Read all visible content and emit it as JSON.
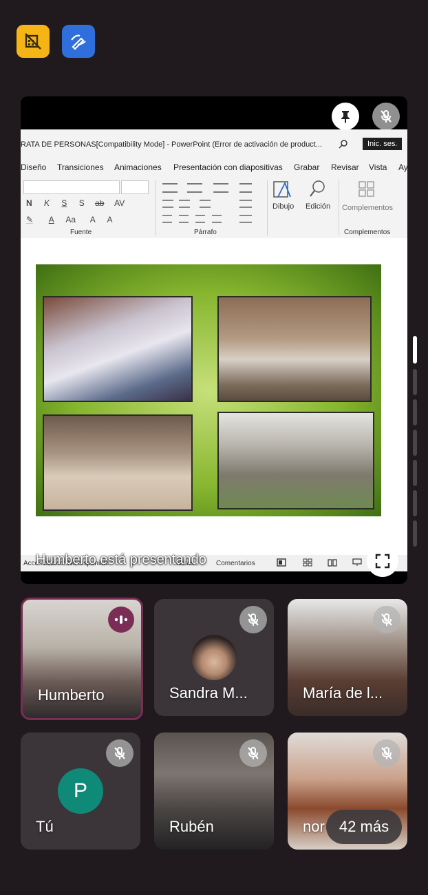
{
  "toolbar": {
    "left_button_icon": "no-video-icon",
    "right_button_icon": "pen-annotate-icon",
    "left_color": "#f5b516",
    "right_color": "#2f6fdb"
  },
  "presentation": {
    "window_title": "RATA DE PERSONAS[Compatibility Mode]  -  PowerPoint (Error de activación de product...",
    "signin_label": "Inic. ses.",
    "tabs": [
      "Diseño",
      "Transiciones",
      "Animaciones",
      "Presentación con diapositivas",
      "Grabar",
      "Revisar",
      "Vista",
      "Ay"
    ],
    "ribbon": {
      "font_group": "Fuente",
      "paragraph_group": "Párrafo",
      "draw_label": "Dibujo",
      "edit_label": "Edición",
      "addins_label": "Complementos",
      "addins_group": "Complementos",
      "font_buttons": [
        "N",
        "K",
        "S",
        "S",
        "ab",
        "AV"
      ],
      "font_buttons2": [
        "Aa",
        "A",
        "A",
        "A"
      ]
    },
    "statusbar": {
      "accessibility": "Accesibilidad: No disponible",
      "notes": "Notas",
      "comments": "Comentarios"
    },
    "presenter_caption": "Humberto está presentando"
  },
  "participants": [
    {
      "name": "Humberto",
      "state": "speaking",
      "avatar": ""
    },
    {
      "name": "Sandra M...",
      "state": "muted",
      "avatar": ""
    },
    {
      "name": "María de l...",
      "state": "muted",
      "avatar": ""
    },
    {
      "name": "Tú",
      "state": "muted",
      "avatar": "P"
    },
    {
      "name": "Rubén",
      "state": "muted",
      "avatar": ""
    },
    {
      "name": "nor",
      "state": "muted",
      "avatar": ""
    }
  ],
  "more_participants": "42 más",
  "colors": {
    "speaking_border": "#7a2e55",
    "speaking_badge": "#7a2e55",
    "self_avatar": "#0f8a78",
    "background": "#201a1e"
  }
}
